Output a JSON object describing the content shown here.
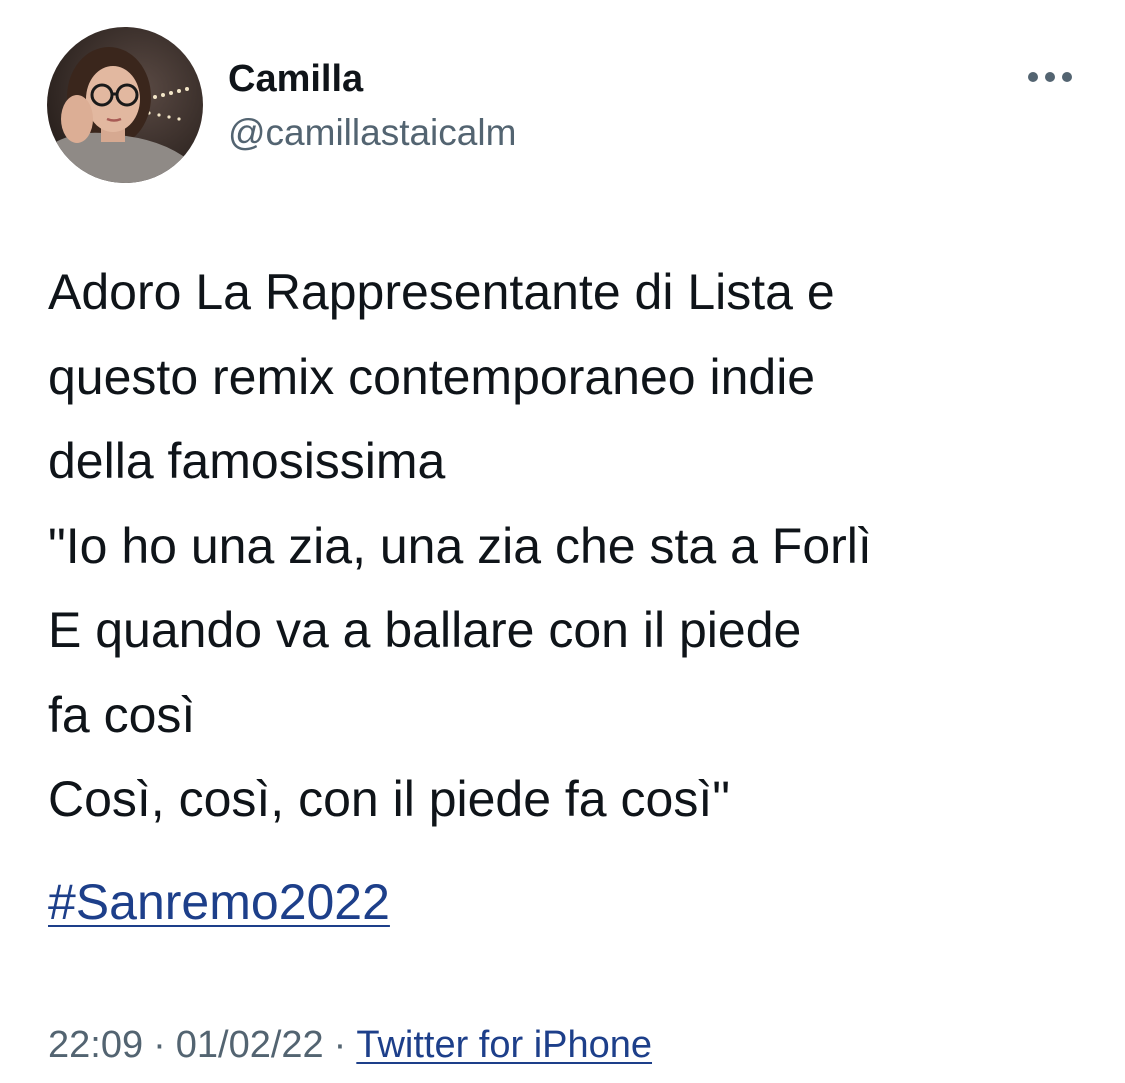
{
  "author": {
    "display_name": "Camilla",
    "handle": "@camillastaicalm"
  },
  "tweet": {
    "lines": [
      "Adoro La Rappresentante di Lista e",
      "questo remix contemporaneo indie",
      "della famosissima",
      "\"Io ho una zia, una zia che sta a Forlì",
      "E quando va a ballare con il piede",
      "fa così",
      "Così, così, con il piede fa così\""
    ],
    "hashtag": "#Sanremo2022"
  },
  "meta": {
    "time": "22:09",
    "date": "01/02/22",
    "separator": "·",
    "source": "Twitter for iPhone"
  },
  "icons": {
    "more": "more-horizontal-icon",
    "avatar": "profile-photo"
  },
  "colors": {
    "text": "#0f1419",
    "secondary": "#536471",
    "link": "#1d3f8a",
    "background": "#ffffff"
  }
}
